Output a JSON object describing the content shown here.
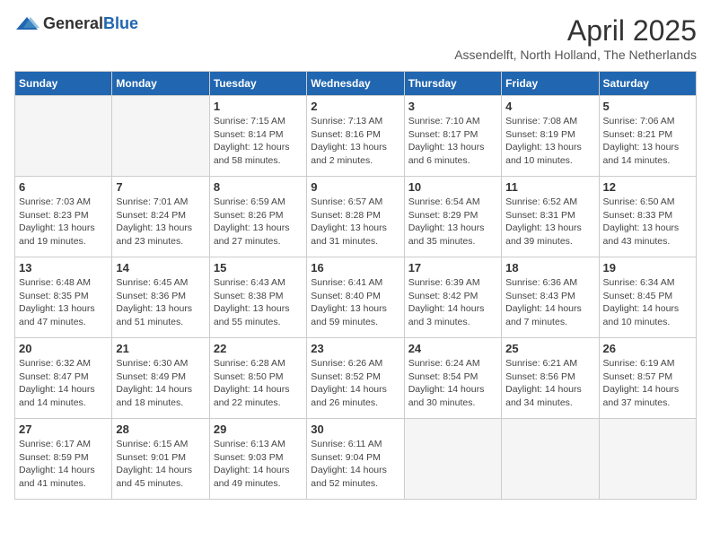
{
  "header": {
    "logo_general": "General",
    "logo_blue": "Blue",
    "month_title": "April 2025",
    "location": "Assendelft, North Holland, The Netherlands"
  },
  "days_of_week": [
    "Sunday",
    "Monday",
    "Tuesday",
    "Wednesday",
    "Thursday",
    "Friday",
    "Saturday"
  ],
  "weeks": [
    [
      {
        "day": "",
        "info": ""
      },
      {
        "day": "",
        "info": ""
      },
      {
        "day": "1",
        "info": "Sunrise: 7:15 AM\nSunset: 8:14 PM\nDaylight: 12 hours and 58 minutes."
      },
      {
        "day": "2",
        "info": "Sunrise: 7:13 AM\nSunset: 8:16 PM\nDaylight: 13 hours and 2 minutes."
      },
      {
        "day": "3",
        "info": "Sunrise: 7:10 AM\nSunset: 8:17 PM\nDaylight: 13 hours and 6 minutes."
      },
      {
        "day": "4",
        "info": "Sunrise: 7:08 AM\nSunset: 8:19 PM\nDaylight: 13 hours and 10 minutes."
      },
      {
        "day": "5",
        "info": "Sunrise: 7:06 AM\nSunset: 8:21 PM\nDaylight: 13 hours and 14 minutes."
      }
    ],
    [
      {
        "day": "6",
        "info": "Sunrise: 7:03 AM\nSunset: 8:23 PM\nDaylight: 13 hours and 19 minutes."
      },
      {
        "day": "7",
        "info": "Sunrise: 7:01 AM\nSunset: 8:24 PM\nDaylight: 13 hours and 23 minutes."
      },
      {
        "day": "8",
        "info": "Sunrise: 6:59 AM\nSunset: 8:26 PM\nDaylight: 13 hours and 27 minutes."
      },
      {
        "day": "9",
        "info": "Sunrise: 6:57 AM\nSunset: 8:28 PM\nDaylight: 13 hours and 31 minutes."
      },
      {
        "day": "10",
        "info": "Sunrise: 6:54 AM\nSunset: 8:29 PM\nDaylight: 13 hours and 35 minutes."
      },
      {
        "day": "11",
        "info": "Sunrise: 6:52 AM\nSunset: 8:31 PM\nDaylight: 13 hours and 39 minutes."
      },
      {
        "day": "12",
        "info": "Sunrise: 6:50 AM\nSunset: 8:33 PM\nDaylight: 13 hours and 43 minutes."
      }
    ],
    [
      {
        "day": "13",
        "info": "Sunrise: 6:48 AM\nSunset: 8:35 PM\nDaylight: 13 hours and 47 minutes."
      },
      {
        "day": "14",
        "info": "Sunrise: 6:45 AM\nSunset: 8:36 PM\nDaylight: 13 hours and 51 minutes."
      },
      {
        "day": "15",
        "info": "Sunrise: 6:43 AM\nSunset: 8:38 PM\nDaylight: 13 hours and 55 minutes."
      },
      {
        "day": "16",
        "info": "Sunrise: 6:41 AM\nSunset: 8:40 PM\nDaylight: 13 hours and 59 minutes."
      },
      {
        "day": "17",
        "info": "Sunrise: 6:39 AM\nSunset: 8:42 PM\nDaylight: 14 hours and 3 minutes."
      },
      {
        "day": "18",
        "info": "Sunrise: 6:36 AM\nSunset: 8:43 PM\nDaylight: 14 hours and 7 minutes."
      },
      {
        "day": "19",
        "info": "Sunrise: 6:34 AM\nSunset: 8:45 PM\nDaylight: 14 hours and 10 minutes."
      }
    ],
    [
      {
        "day": "20",
        "info": "Sunrise: 6:32 AM\nSunset: 8:47 PM\nDaylight: 14 hours and 14 minutes."
      },
      {
        "day": "21",
        "info": "Sunrise: 6:30 AM\nSunset: 8:49 PM\nDaylight: 14 hours and 18 minutes."
      },
      {
        "day": "22",
        "info": "Sunrise: 6:28 AM\nSunset: 8:50 PM\nDaylight: 14 hours and 22 minutes."
      },
      {
        "day": "23",
        "info": "Sunrise: 6:26 AM\nSunset: 8:52 PM\nDaylight: 14 hours and 26 minutes."
      },
      {
        "day": "24",
        "info": "Sunrise: 6:24 AM\nSunset: 8:54 PM\nDaylight: 14 hours and 30 minutes."
      },
      {
        "day": "25",
        "info": "Sunrise: 6:21 AM\nSunset: 8:56 PM\nDaylight: 14 hours and 34 minutes."
      },
      {
        "day": "26",
        "info": "Sunrise: 6:19 AM\nSunset: 8:57 PM\nDaylight: 14 hours and 37 minutes."
      }
    ],
    [
      {
        "day": "27",
        "info": "Sunrise: 6:17 AM\nSunset: 8:59 PM\nDaylight: 14 hours and 41 minutes."
      },
      {
        "day": "28",
        "info": "Sunrise: 6:15 AM\nSunset: 9:01 PM\nDaylight: 14 hours and 45 minutes."
      },
      {
        "day": "29",
        "info": "Sunrise: 6:13 AM\nSunset: 9:03 PM\nDaylight: 14 hours and 49 minutes."
      },
      {
        "day": "30",
        "info": "Sunrise: 6:11 AM\nSunset: 9:04 PM\nDaylight: 14 hours and 52 minutes."
      },
      {
        "day": "",
        "info": ""
      },
      {
        "day": "",
        "info": ""
      },
      {
        "day": "",
        "info": ""
      }
    ]
  ]
}
